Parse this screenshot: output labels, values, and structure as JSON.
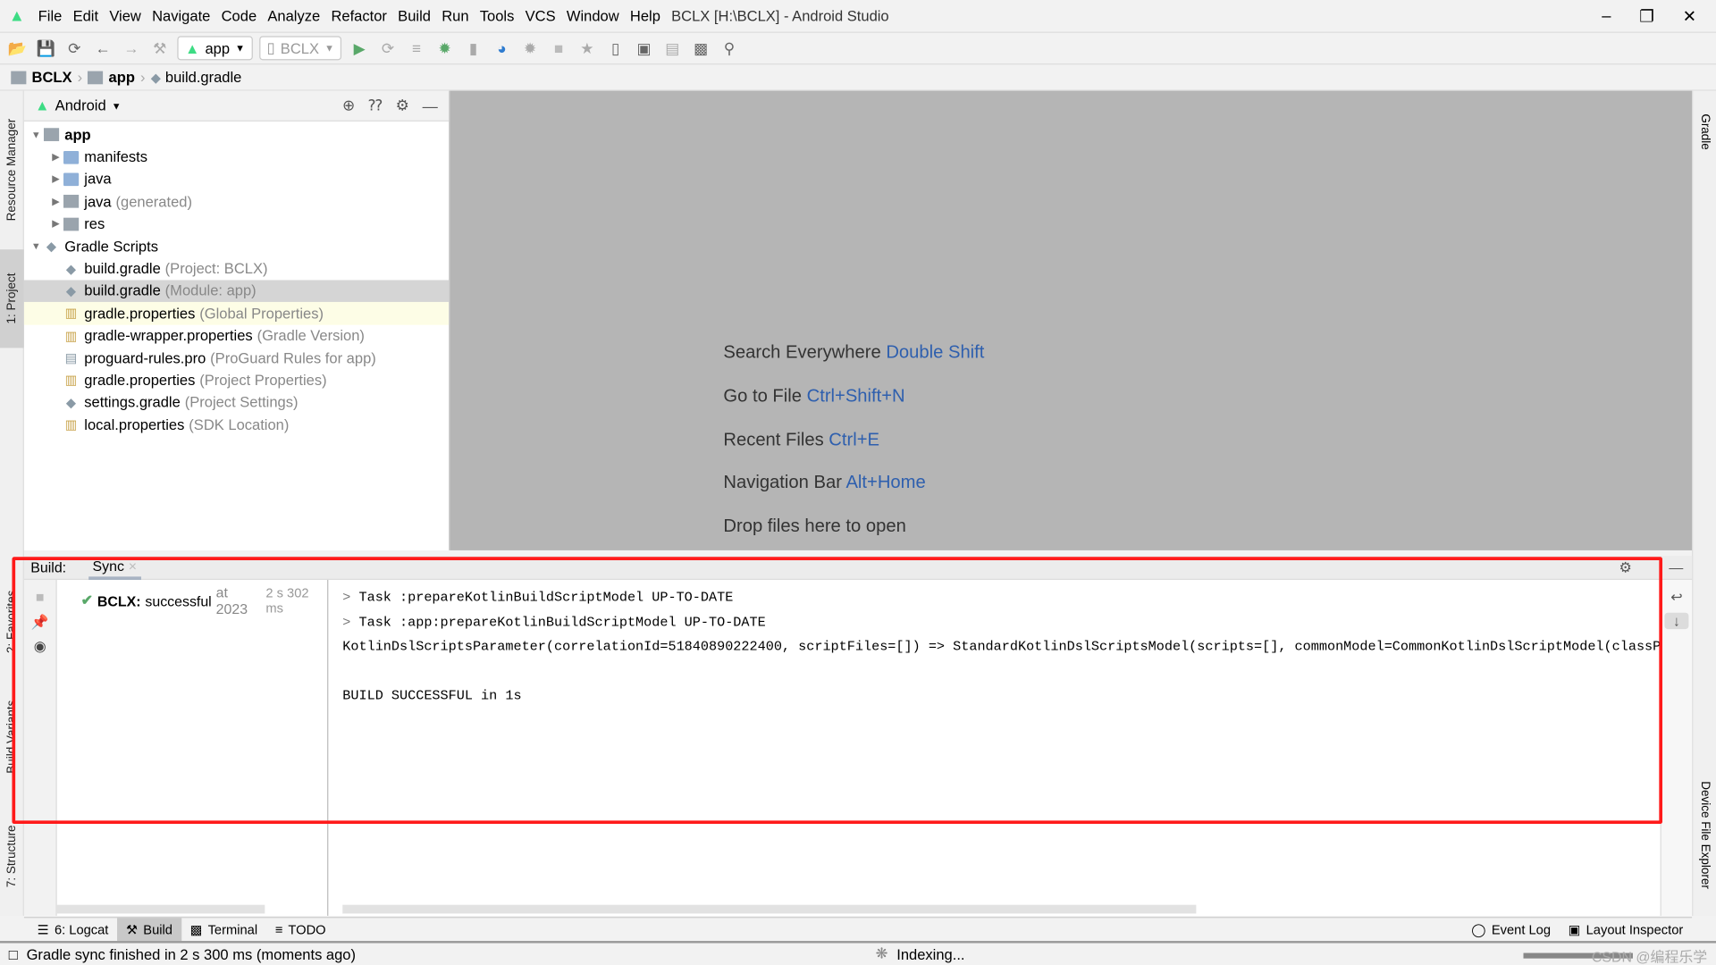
{
  "window": {
    "title": "BCLX [H:\\BCLX] - Android Studio",
    "controls": [
      "minimize",
      "restore",
      "close"
    ]
  },
  "menu": [
    "File",
    "Edit",
    "View",
    "Navigate",
    "Code",
    "Analyze",
    "Refactor",
    "Build",
    "Run",
    "Tools",
    "VCS",
    "Window",
    "Help"
  ],
  "toolbar": {
    "run_config": "app",
    "device": "BCLX"
  },
  "breadcrumb": [
    "BCLX",
    "app",
    "build.gradle"
  ],
  "left_tabs": [
    "Resource Manager",
    "1: Project",
    "2: Favorites",
    "Build Variants",
    "7: Structure"
  ],
  "right_tabs": [
    "Gradle",
    "Device File Explorer"
  ],
  "project": {
    "view": "Android",
    "items": [
      {
        "label": "app",
        "hint": "",
        "level": 0,
        "expanded": true,
        "bold": true,
        "icon": "module-folder"
      },
      {
        "label": "manifests",
        "hint": "",
        "level": 1,
        "expanded": false,
        "icon": "folder"
      },
      {
        "label": "java",
        "hint": "",
        "level": 1,
        "expanded": false,
        "icon": "folder"
      },
      {
        "label": "java",
        "hint": "(generated)",
        "level": 1,
        "expanded": false,
        "icon": "generated-folder"
      },
      {
        "label": "res",
        "hint": "",
        "level": 1,
        "expanded": false,
        "icon": "res-folder"
      },
      {
        "label": "Gradle Scripts",
        "hint": "",
        "level": 0,
        "expanded": true,
        "icon": "gradle"
      },
      {
        "label": "build.gradle",
        "hint": "(Project: BCLX)",
        "level": 1,
        "icon": "gradle"
      },
      {
        "label": "build.gradle",
        "hint": "(Module: app)",
        "level": 1,
        "icon": "gradle",
        "selected": true
      },
      {
        "label": "gradle.properties",
        "hint": "(Global Properties)",
        "level": 1,
        "icon": "properties",
        "highlight": true
      },
      {
        "label": "gradle-wrapper.properties",
        "hint": "(Gradle Version)",
        "level": 1,
        "icon": "properties"
      },
      {
        "label": "proguard-rules.pro",
        "hint": "(ProGuard Rules for app)",
        "level": 1,
        "icon": "text-file"
      },
      {
        "label": "gradle.properties",
        "hint": "(Project Properties)",
        "level": 1,
        "icon": "properties"
      },
      {
        "label": "settings.gradle",
        "hint": "(Project Settings)",
        "level": 1,
        "icon": "gradle"
      },
      {
        "label": "local.properties",
        "hint": "(SDK Location)",
        "level": 1,
        "icon": "properties"
      }
    ]
  },
  "editor": {
    "hints": [
      {
        "text": "Search Everywhere",
        "key": "Double Shift"
      },
      {
        "text": "Go to File",
        "key": "Ctrl+Shift+N"
      },
      {
        "text": "Recent Files",
        "key": "Ctrl+E"
      },
      {
        "text": "Navigation Bar",
        "key": "Alt+Home"
      },
      {
        "text": "Drop files here to open",
        "key": ""
      }
    ]
  },
  "build": {
    "label": "Build:",
    "tab": "Sync",
    "result_name": "BCLX:",
    "result_status": "successful",
    "result_time": "at 2023",
    "result_duration": "2 s 302 ms",
    "console": [
      "Task :prepareKotlinBuildScriptModel UP-TO-DATE",
      "Task :app:prepareKotlinBuildScriptModel UP-TO-DATE",
      "KotlinDslScriptsParameter(correlationId=51840890222400, scriptFiles=[]) => StandardKotlinDslScriptsModel(scripts=[], commonModel=CommonKotlinDslScriptModel(classPath=[], sourcePath=[], implicitImports=[]), editorReports=[], exceptions=[], outputs=[])",
      "",
      "BUILD SUCCESSFUL in 1s"
    ]
  },
  "tool_windows": {
    "left": [
      "6: Logcat",
      "Build",
      "Terminal",
      "TODO"
    ],
    "right": [
      "Event Log",
      "Layout Inspector"
    ]
  },
  "status": {
    "message": "Gradle sync finished in 2 s 300 ms (moments ago)",
    "indexing": "Indexing...",
    "watermark": "CSDN @编程乐学"
  },
  "colors": {
    "accent": "#2e5fae",
    "success": "#59a869",
    "highlight_box": "#ff1a1a",
    "android": "#3ddc84"
  }
}
